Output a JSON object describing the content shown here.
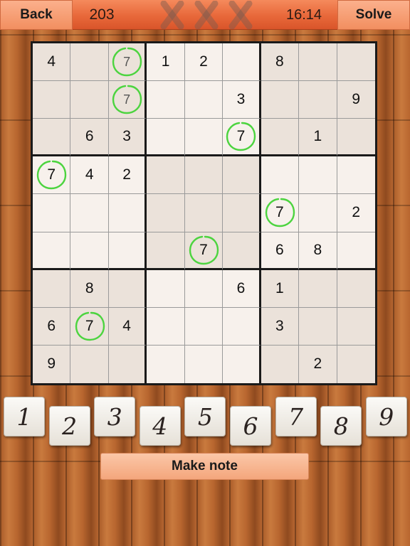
{
  "header": {
    "back_label": "Back",
    "score": "203",
    "mistakes_max": 3,
    "mistakes_made": 0,
    "timer": "16:14",
    "solve_label": "Solve"
  },
  "board": {
    "rows": [
      [
        "4",
        "",
        "7",
        "1",
        "2",
        "",
        "8",
        "",
        ""
      ],
      [
        "",
        "",
        "7",
        "",
        "",
        "3",
        "",
        "",
        "9"
      ],
      [
        "",
        "6",
        "3",
        "",
        "",
        "7",
        "",
        "1",
        ""
      ],
      [
        "7",
        "4",
        "2",
        "",
        "",
        "",
        "",
        "",
        ""
      ],
      [
        "",
        "",
        "",
        "",
        "",
        "",
        "7",
        "",
        "2"
      ],
      [
        "",
        "",
        "",
        "",
        "7",
        "",
        "6",
        "8",
        ""
      ],
      [
        "",
        "8",
        "",
        "",
        "",
        "6",
        "1",
        "",
        ""
      ],
      [
        "6",
        "7",
        "4",
        "",
        "",
        "",
        "3",
        "",
        ""
      ],
      [
        "9",
        "",
        "",
        "",
        "",
        "",
        "",
        "2",
        ""
      ]
    ],
    "highlighted_digit": "7",
    "notes": [
      [
        0,
        2
      ],
      [
        1,
        2
      ]
    ],
    "highlight_color": "#4cd43f"
  },
  "keypad": {
    "keys": [
      "1",
      "2",
      "3",
      "4",
      "5",
      "6",
      "7",
      "8",
      "9"
    ]
  },
  "make_note_label": "Make note",
  "colors": {
    "topbar": "#e8683a",
    "button": "#f28f60",
    "wood": "#b8662f",
    "board_bg": "#f4ece4"
  }
}
